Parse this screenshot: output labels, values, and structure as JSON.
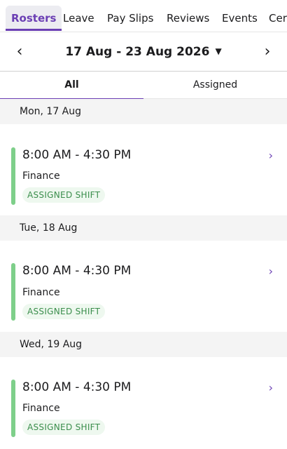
{
  "top_tabs": [
    {
      "label": "Rosters",
      "active": true
    },
    {
      "label": "Leave",
      "active": false
    },
    {
      "label": "Pay Slips",
      "active": false
    },
    {
      "label": "Reviews",
      "active": false
    },
    {
      "label": "Events",
      "active": false
    },
    {
      "label": "Cer",
      "active": false
    }
  ],
  "week_nav": {
    "label": "17 Aug - 23 Aug 2026",
    "prev_icon": "chevron-left-icon",
    "next_icon": "chevron-right-icon",
    "caret_icon": "caret-down-icon"
  },
  "filter_tabs": [
    {
      "label": "All",
      "active": true
    },
    {
      "label": "Assigned",
      "active": false
    }
  ],
  "days": [
    {
      "date": "Mon, 17 Aug",
      "shift": {
        "time": "8:00 AM - 4:30 PM",
        "department": "Finance",
        "status": "ASSIGNED SHIFT"
      }
    },
    {
      "date": "Tue, 18 Aug",
      "shift": {
        "time": "8:00 AM - 4:30 PM",
        "department": "Finance",
        "status": "ASSIGNED SHIFT"
      }
    },
    {
      "date": "Wed, 19 Aug",
      "shift": {
        "time": "8:00 AM - 4:30 PM",
        "department": "Finance",
        "status": "ASSIGNED SHIFT"
      }
    }
  ],
  "colors": {
    "accent": "#6b3fb4",
    "shift_bar": "#7ecf8a",
    "badge_bg": "#eef8ef",
    "badge_text": "#3b8e4c",
    "day_header_bg": "#f4f4f4"
  }
}
